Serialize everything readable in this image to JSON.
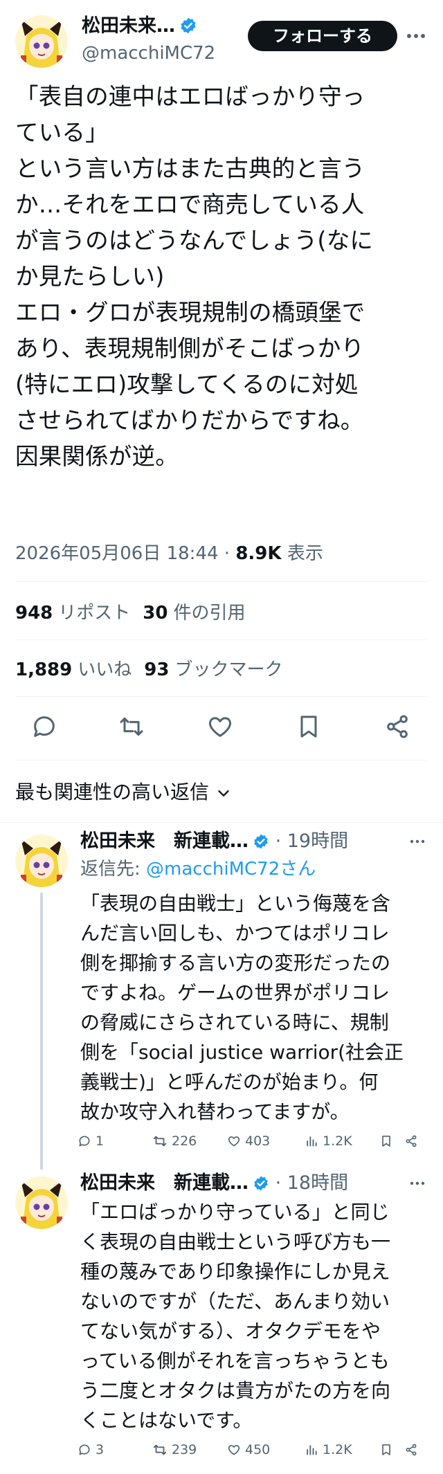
{
  "post": {
    "author_name": "松田未来…",
    "author_handle": "@macchiMC72",
    "follow_label": "フォローする",
    "text": "「表自の連中はエロばっかり守っ\nている」\nという言い方はまた古典的と言う\nか…それをエロで商売している人\nが言うのはどうなんでしょう(なに\nか見たらしい)\nエロ・グロが表現規制の橋頭堡で\nあり、表現規制側がそこばっかり\n(特にエロ)攻撃してくるのに対処\nさせられてばかりだからですね。\n因果関係が逆。",
    "timestamp": "2026年05月06日 18:44",
    "separator": "·",
    "views": "8.9K",
    "views_label": "表示"
  },
  "stats": {
    "reposts": "948",
    "reposts_label": "リポスト",
    "quotes": "30",
    "quotes_label": "件の引用",
    "likes": "1,889",
    "likes_label": "いいね",
    "bookmarks": "93",
    "bookmarks_label": "ブックマーク"
  },
  "actions": [
    "reply-icon",
    "repost-icon",
    "like-icon",
    "bookmark-icon",
    "share-icon"
  ],
  "sort": {
    "label": "最も関連性の高い返信"
  },
  "replies": [
    {
      "name": "松田未来　新連載…",
      "time": "· 19時間",
      "reply_to_label": "返信先: ",
      "reply_to_handle": "@macchiMC72さん",
      "text": "「表現の自由戦士」という侮蔑を含\nんだ言い回しも、かつてはポリコレ\n側を揶揄する言い方の変形だったの\nですよね。ゲームの世界がポリコレ\nの脅威にさらされている時に、規制\n側を「social justice warrior(社会正\n義戦士)」と呼んだのが始まり。何\n故か攻守入れ替わってますが。",
      "replies": "1",
      "reposts": "226",
      "likes": "403",
      "views": "1.2K"
    },
    {
      "name": "松田未来　新連載…",
      "time": "· 18時間",
      "text": "「エロばっかり守っている」と同じ\nく表現の自由戦士という呼び方も一\n種の蔑みであり印象操作にしか見え\nないのですが（ただ、あんまり効い\nてない気がする）、オタクデモをや\nっている側がそれを言っちゃうとも\nう二度とオタクは貴方がたの方を向\nくことはないです。",
      "replies": "3",
      "reposts": "239",
      "likes": "450",
      "views": "1.2K"
    }
  ],
  "colors": {
    "text": "#0f1419",
    "secondary": "#536471",
    "accent": "#1d9bf0",
    "divider": "#eff3f4",
    "button": "#0f1419"
  }
}
